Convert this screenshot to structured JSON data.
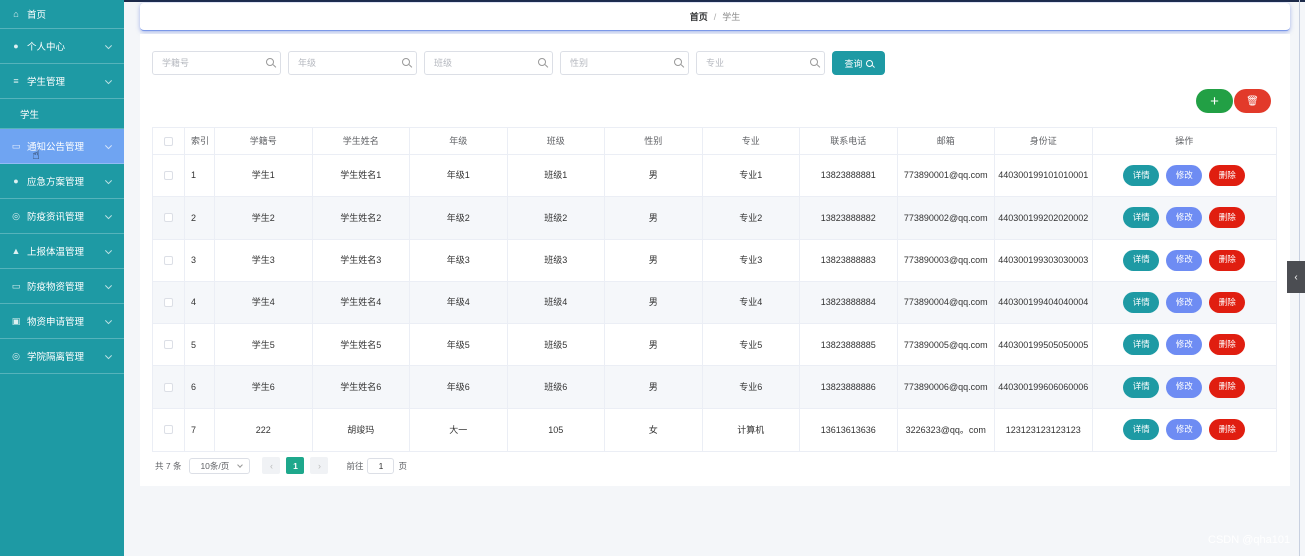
{
  "sidebar": {
    "items": [
      {
        "label": "首页",
        "icon": "home-icon",
        "glyph": "⌂"
      },
      {
        "label": "个人中心",
        "icon": "user-icon",
        "glyph": "●"
      },
      {
        "label": "学生管理",
        "icon": "list-icon",
        "glyph": "≡"
      },
      {
        "label": "学生",
        "sub": true
      },
      {
        "label": "通知公告管理",
        "icon": "notice-icon",
        "glyph": "▭"
      },
      {
        "label": "应急方案管理",
        "icon": "user-icon",
        "glyph": "●"
      },
      {
        "label": "防疫资讯管理",
        "icon": "globe-icon",
        "glyph": "◎"
      },
      {
        "label": "上报体温管理",
        "icon": "chart-icon",
        "glyph": "▲"
      },
      {
        "label": "防疫物资管理",
        "icon": "box-icon",
        "glyph": "▭"
      },
      {
        "label": "物资申请管理",
        "icon": "box-icon",
        "glyph": "▣"
      },
      {
        "label": "学院隔离管理",
        "icon": "globe-icon",
        "glyph": "◎"
      }
    ]
  },
  "breadcrumb": {
    "home": "首页",
    "separator": "/",
    "current": "学生"
  },
  "search": {
    "fields": [
      {
        "placeholder": "学籍号"
      },
      {
        "placeholder": "年级"
      },
      {
        "placeholder": "班级"
      },
      {
        "placeholder": "性别"
      },
      {
        "placeholder": "专业"
      }
    ],
    "query_label": "查询"
  },
  "actions": {
    "add_glyph": "+",
    "delete_glyph": "🗑"
  },
  "table": {
    "headers": [
      "索引",
      "学籍号",
      "学生姓名",
      "年级",
      "班级",
      "性别",
      "专业",
      "联系电话",
      "邮箱",
      "身份证",
      "操作"
    ],
    "rows": [
      [
        "1",
        "学生1",
        "学生姓名1",
        "年级1",
        "班级1",
        "男",
        "专业1",
        "13823888881",
        "773890001@qq.com",
        "440300199101010001"
      ],
      [
        "2",
        "学生2",
        "学生姓名2",
        "年级2",
        "班级2",
        "男",
        "专业2",
        "13823888882",
        "773890002@qq.com",
        "440300199202020002"
      ],
      [
        "3",
        "学生3",
        "学生姓名3",
        "年级3",
        "班级3",
        "男",
        "专业3",
        "13823888883",
        "773890003@qq.com",
        "440300199303030003"
      ],
      [
        "4",
        "学生4",
        "学生姓名4",
        "年级4",
        "班级4",
        "男",
        "专业4",
        "13823888884",
        "773890004@qq.com",
        "440300199404040004"
      ],
      [
        "5",
        "学生5",
        "学生姓名5",
        "年级5",
        "班级5",
        "男",
        "专业5",
        "13823888885",
        "773890005@qq.com",
        "440300199505050005"
      ],
      [
        "6",
        "学生6",
        "学生姓名6",
        "年级6",
        "班级6",
        "男",
        "专业6",
        "13823888886",
        "773890006@qq.com",
        "440300199606060006"
      ],
      [
        "7",
        "222",
        "胡竣玛",
        "大一",
        "105",
        "女",
        "计算机",
        "13613613636",
        "3226323@qq。com",
        "123123123123123"
      ]
    ],
    "row_actions": {
      "detail": "详情",
      "edit": "修改",
      "delete": "删除"
    }
  },
  "pagination": {
    "total": "共 7 条",
    "page_size": "10条/页",
    "prev": "‹",
    "current_page": "1",
    "next": "›",
    "goto_label": "前往",
    "goto_value": "1",
    "page_suffix": "页"
  },
  "edge_toggle": "‹",
  "watermark": "CSDN @qha101",
  "colors": {
    "sidebar": "#1e9aa4",
    "active": "#6fa4f2",
    "add": "#22a045",
    "delete": "#e01e10",
    "edit": "#6e8cf3"
  }
}
